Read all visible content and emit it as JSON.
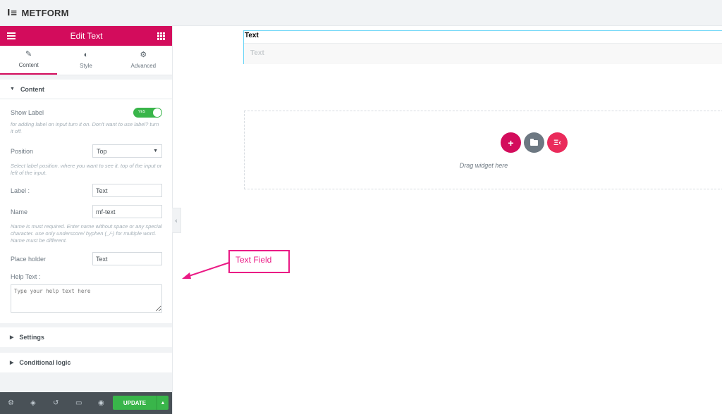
{
  "app": {
    "title": "METFORM",
    "logo_icon": "elementor-logo-icon"
  },
  "panel": {
    "header": {
      "title": "Edit Text",
      "menu_icon": "hamburger-icon",
      "grid_icon": "apps-grid-icon"
    },
    "tabs": [
      {
        "label": "Content",
        "icon": "pencil-icon",
        "active": true
      },
      {
        "label": "Style",
        "icon": "half-circle-icon",
        "active": false
      },
      {
        "label": "Advanced",
        "icon": "gear-icon",
        "active": false
      }
    ],
    "content_section": {
      "title": "Content",
      "show_label": {
        "label": "Show Label",
        "toggle_text": "YES",
        "enabled": true,
        "description": "for adding label on input turn it on. Don't want to use label? turn it off."
      },
      "position": {
        "label": "Position",
        "value": "Top",
        "description": "Select label position. where you want to see it. top of the input or left of the input."
      },
      "label_field": {
        "label": "Label :",
        "value": "Text"
      },
      "name_field": {
        "label": "Name",
        "value": "mf-text",
        "description": "Name is must required. Enter name without space or any special character. use only underscore/ hyphen (_/-) for multiple word. Name must be different."
      },
      "placeholder_field": {
        "label": "Place holder",
        "value": "Text"
      },
      "help_text": {
        "label": "Help Text :",
        "placeholder": "Type your help text here"
      }
    },
    "sections": [
      {
        "title": "Settings"
      },
      {
        "title": "Conditional logic"
      }
    ],
    "footer": {
      "icons": [
        "gear-icon",
        "layers-icon",
        "history-icon",
        "responsive-icon",
        "eye-icon"
      ],
      "update_label": "UPDATE"
    }
  },
  "canvas": {
    "field": {
      "label": "Text",
      "placeholder": "Text"
    },
    "dropzone": {
      "hint": "Drag widget here",
      "add_color": "#d30c5c",
      "template_color": "#6d7882",
      "ekit_color": "#ea2b5b"
    }
  },
  "annotation": {
    "label": "Text Field",
    "color": "#ea1a85"
  }
}
